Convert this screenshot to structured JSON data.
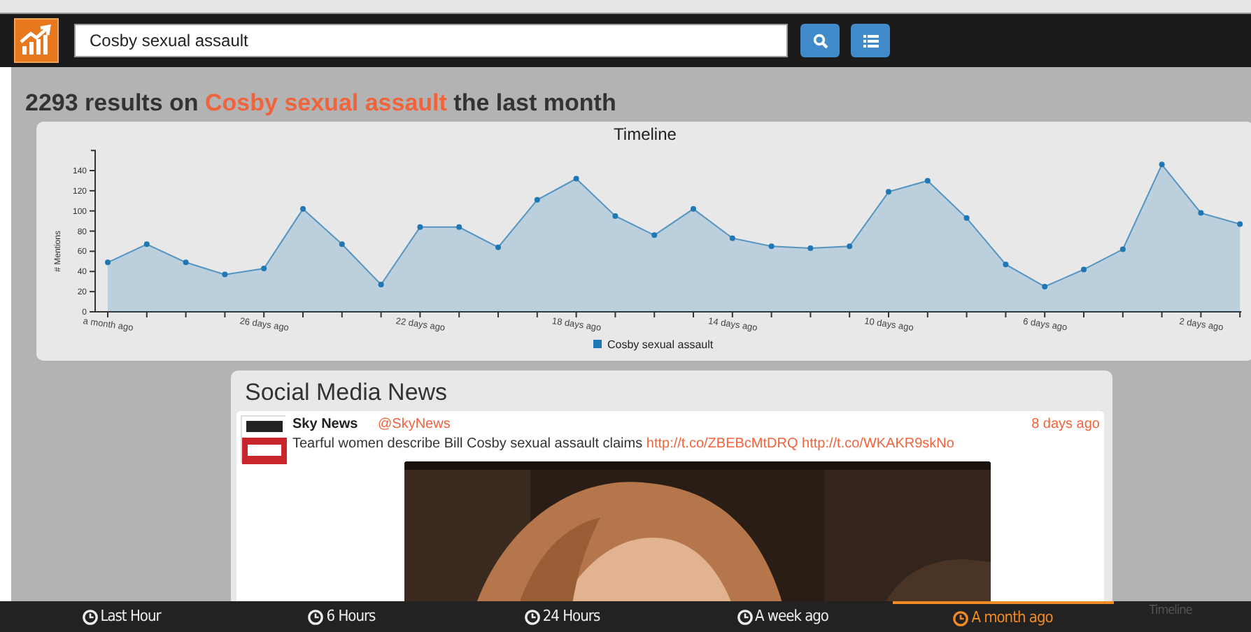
{
  "search": {
    "value": "Cosby sexual assault"
  },
  "heading": {
    "count": "2293",
    "prefix": "results on",
    "query": "Cosby sexual assault",
    "suffix": "the last month"
  },
  "timeline": {
    "chart_data": {
      "type": "area",
      "title": "Timeline",
      "ylabel": "# Mentions",
      "x": [
        "a month ago",
        null,
        null,
        null,
        "26 days ago",
        null,
        null,
        null,
        "22 days ago",
        null,
        null,
        null,
        "18 days ago",
        null,
        null,
        null,
        "14 days ago",
        null,
        null,
        null,
        "10 days ago",
        null,
        null,
        null,
        "6 days ago",
        null,
        null,
        null,
        "2 days ago",
        null
      ],
      "yticks": [
        0,
        20,
        40,
        60,
        80,
        100,
        120,
        140
      ],
      "ylim": [
        0,
        160
      ],
      "series": [
        {
          "name": "Cosby sexual assault",
          "color": "#1f77b4",
          "values": [
            49,
            67,
            49,
            37,
            43,
            102,
            67,
            27,
            84,
            84,
            64,
            111,
            132,
            95,
            76,
            102,
            73,
            65,
            63,
            65,
            119,
            130,
            93,
            47,
            25,
            42,
            62,
            146,
            98,
            87
          ]
        }
      ]
    }
  },
  "news": {
    "title": "Social Media News",
    "posts": [
      {
        "author": "Sky News",
        "handle": "@SkyNews",
        "time": "8 days ago",
        "text": "Tearful women describe Bill Cosby sexual assault claims",
        "links": [
          "http://t.co/ZBEBcMtDRQ",
          "http://t.co/WKAKR9skNo"
        ]
      }
    ]
  },
  "bottom_tabs": [
    {
      "label": "Last Hour",
      "selected": false,
      "kind": "clock"
    },
    {
      "label": "6 Hours",
      "selected": false,
      "kind": "clock"
    },
    {
      "label": "24 Hours",
      "selected": false,
      "kind": "clock"
    },
    {
      "label": "A week ago",
      "selected": false,
      "kind": "clock"
    },
    {
      "label": "A month ago",
      "selected": true,
      "kind": "clock"
    },
    {
      "label": "Timeline",
      "selected": false,
      "kind": "plain"
    }
  ]
}
